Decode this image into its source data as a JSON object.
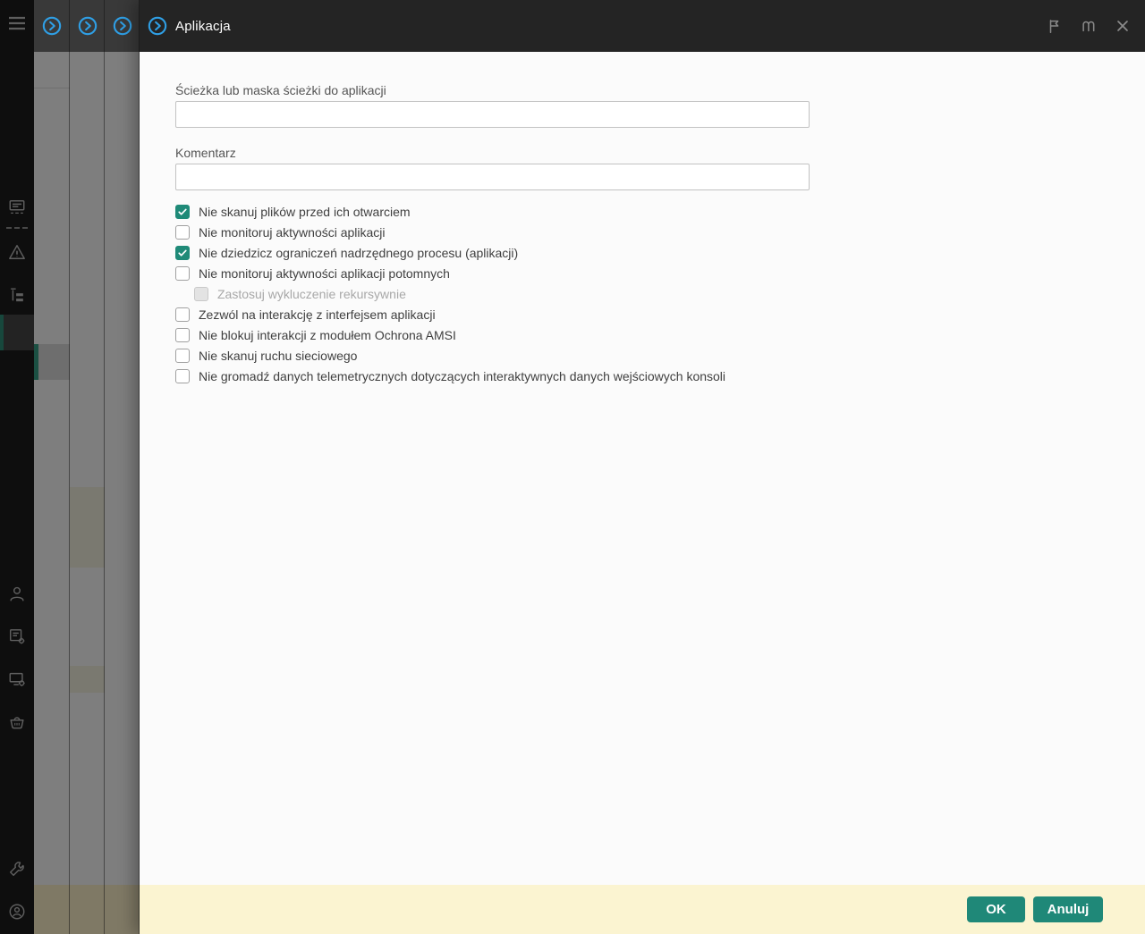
{
  "window": {
    "title": "Aplikacja",
    "stacked_panels_count": 3
  },
  "header_actions": {
    "flag": "flag-icon",
    "help": "book-icon",
    "close": "close-icon"
  },
  "form": {
    "path_field": {
      "label": "Ścieżka lub maska ścieżki do aplikacji",
      "value": "",
      "placeholder": ""
    },
    "comment_field": {
      "label": "Komentarz",
      "value": "",
      "placeholder": ""
    }
  },
  "checkboxes": [
    {
      "label": "Nie skanuj plików przed ich otwarciem",
      "checked": true,
      "disabled": false,
      "indent": false
    },
    {
      "label": "Nie monitoruj aktywności aplikacji",
      "checked": false,
      "disabled": false,
      "indent": false
    },
    {
      "label": "Nie dziedzicz ograniczeń nadrzędnego procesu (aplikacji)",
      "checked": true,
      "disabled": false,
      "indent": false
    },
    {
      "label": "Nie monitoruj aktywności aplikacji potomnych",
      "checked": false,
      "disabled": false,
      "indent": false
    },
    {
      "label": "Zastosuj wykluczenie rekursywnie",
      "checked": false,
      "disabled": true,
      "indent": true
    },
    {
      "label": "Zezwól na interakcję z interfejsem aplikacji",
      "checked": false,
      "disabled": false,
      "indent": false
    },
    {
      "label": "Nie blokuj interakcji z modułem Ochrona AMSI",
      "checked": false,
      "disabled": false,
      "indent": false
    },
    {
      "label": "Nie skanuj ruchu sieciowego",
      "checked": false,
      "disabled": false,
      "indent": false
    },
    {
      "label": "Nie gromadź danych telemetrycznych dotyczących interaktywnych danych wejściowych konsoli",
      "checked": false,
      "disabled": false,
      "indent": false
    }
  ],
  "footer": {
    "ok": "OK",
    "cancel": "Anuluj"
  },
  "sidebar_icons": [
    "menu-icon",
    "monitoring-icon",
    "alerts-icon",
    "hierarchy-icon",
    "user-icon",
    "policy-gear-icon",
    "device-gear-icon",
    "marketplace-basket-icon",
    "settings-wrench-icon",
    "account-icon"
  ],
  "colors": {
    "accent_teal": "#1F8878",
    "checkbox_checked": "#1F8A78",
    "panel_icon_blue": "#2F9FE5",
    "footer_bg": "#FBF4D1",
    "header_bg": "#242424",
    "overlay_gray": "#7E7E7E"
  }
}
